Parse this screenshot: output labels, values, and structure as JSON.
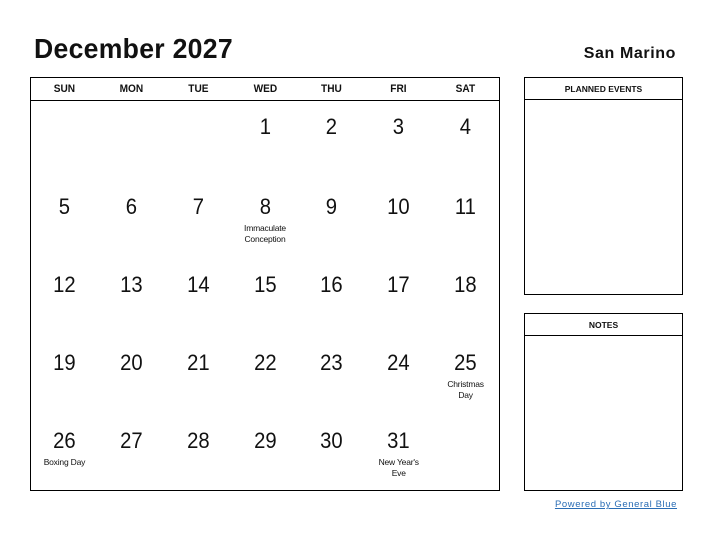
{
  "header": {
    "title": "December 2027",
    "country": "San Marino"
  },
  "calendar": {
    "weekdays": [
      "SUN",
      "MON",
      "TUE",
      "WED",
      "THU",
      "FRI",
      "SAT"
    ],
    "weeks": [
      [
        {
          "day": "",
          "holiday": ""
        },
        {
          "day": "",
          "holiday": ""
        },
        {
          "day": "",
          "holiday": ""
        },
        {
          "day": "1",
          "holiday": ""
        },
        {
          "day": "2",
          "holiday": ""
        },
        {
          "day": "3",
          "holiday": ""
        },
        {
          "day": "4",
          "holiday": ""
        }
      ],
      [
        {
          "day": "5",
          "holiday": ""
        },
        {
          "day": "6",
          "holiday": ""
        },
        {
          "day": "7",
          "holiday": ""
        },
        {
          "day": "8",
          "holiday": "Immaculate Conception"
        },
        {
          "day": "9",
          "holiday": ""
        },
        {
          "day": "10",
          "holiday": ""
        },
        {
          "day": "11",
          "holiday": ""
        }
      ],
      [
        {
          "day": "12",
          "holiday": ""
        },
        {
          "day": "13",
          "holiday": ""
        },
        {
          "day": "14",
          "holiday": ""
        },
        {
          "day": "15",
          "holiday": ""
        },
        {
          "day": "16",
          "holiday": ""
        },
        {
          "day": "17",
          "holiday": ""
        },
        {
          "day": "18",
          "holiday": ""
        }
      ],
      [
        {
          "day": "19",
          "holiday": ""
        },
        {
          "day": "20",
          "holiday": ""
        },
        {
          "day": "21",
          "holiday": ""
        },
        {
          "day": "22",
          "holiday": ""
        },
        {
          "day": "23",
          "holiday": ""
        },
        {
          "day": "24",
          "holiday": ""
        },
        {
          "day": "25",
          "holiday": "Christmas Day"
        }
      ],
      [
        {
          "day": "26",
          "holiday": "Boxing Day"
        },
        {
          "day": "27",
          "holiday": ""
        },
        {
          "day": "28",
          "holiday": ""
        },
        {
          "day": "29",
          "holiday": ""
        },
        {
          "day": "30",
          "holiday": ""
        },
        {
          "day": "31",
          "holiday": "New Year's Eve"
        },
        {
          "day": "",
          "holiday": ""
        }
      ]
    ]
  },
  "panels": {
    "planned_events": "PLANNED EVENTS",
    "notes": "NOTES"
  },
  "footer": {
    "powered_by": "Powered by General Blue",
    "link_color": "#2a6db5"
  }
}
